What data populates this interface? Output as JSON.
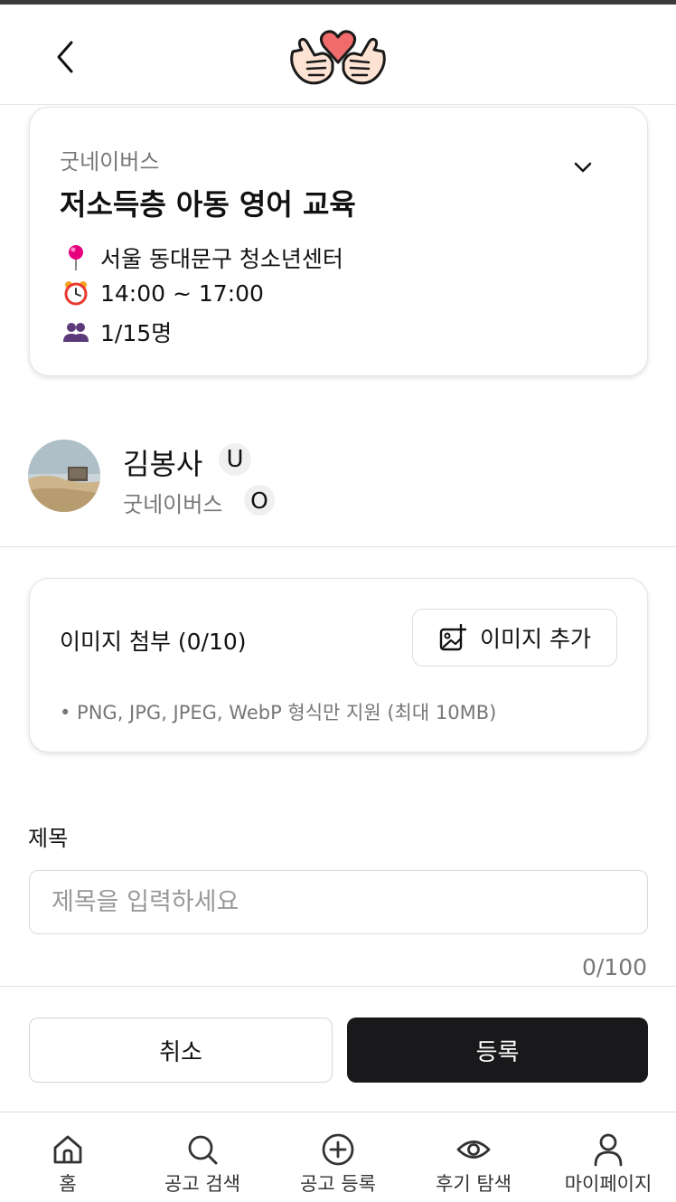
{
  "header": {
    "back_icon": "chevron-left-icon",
    "logo_icon": "heart-hands-logo-icon"
  },
  "activity": {
    "org": "굿네이버스",
    "title": "저소득층 아동 영어 교육",
    "location": "서울 동대문구 청소년센터",
    "time": "14:00 ~ 17:00",
    "people": "1/15명",
    "icons": [
      "pin-icon",
      "alarm-clock-icon",
      "people-icon",
      "chevron-down-icon"
    ],
    "pin_color": "#e6007e"
  },
  "profile": {
    "name": "김봉사",
    "name_badge": "U",
    "org": "굿네이버스",
    "org_badge": "O"
  },
  "attachments": {
    "title": "이미지 첨부 (0/10)",
    "add_button": "이미지 추가",
    "note": "• PNG, JPG, JPEG, WebP 형식만 지원 (최대 10MB)"
  },
  "form": {
    "title_label": "제목",
    "title_placeholder": "제목을 입력하세요",
    "title_value": "",
    "char_count": "0/100"
  },
  "actions": {
    "cancel": "취소",
    "submit": "등록",
    "submit_bg": "#19191b"
  },
  "nav": {
    "items": [
      {
        "label": "홈",
        "icon": "home-icon"
      },
      {
        "label": "공고 검색",
        "icon": "search-icon"
      },
      {
        "label": "공고 등록",
        "icon": "plus-circle-icon"
      },
      {
        "label": "후기 탐색",
        "icon": "eye-icon"
      },
      {
        "label": "마이페이지",
        "icon": "user-icon"
      }
    ]
  }
}
